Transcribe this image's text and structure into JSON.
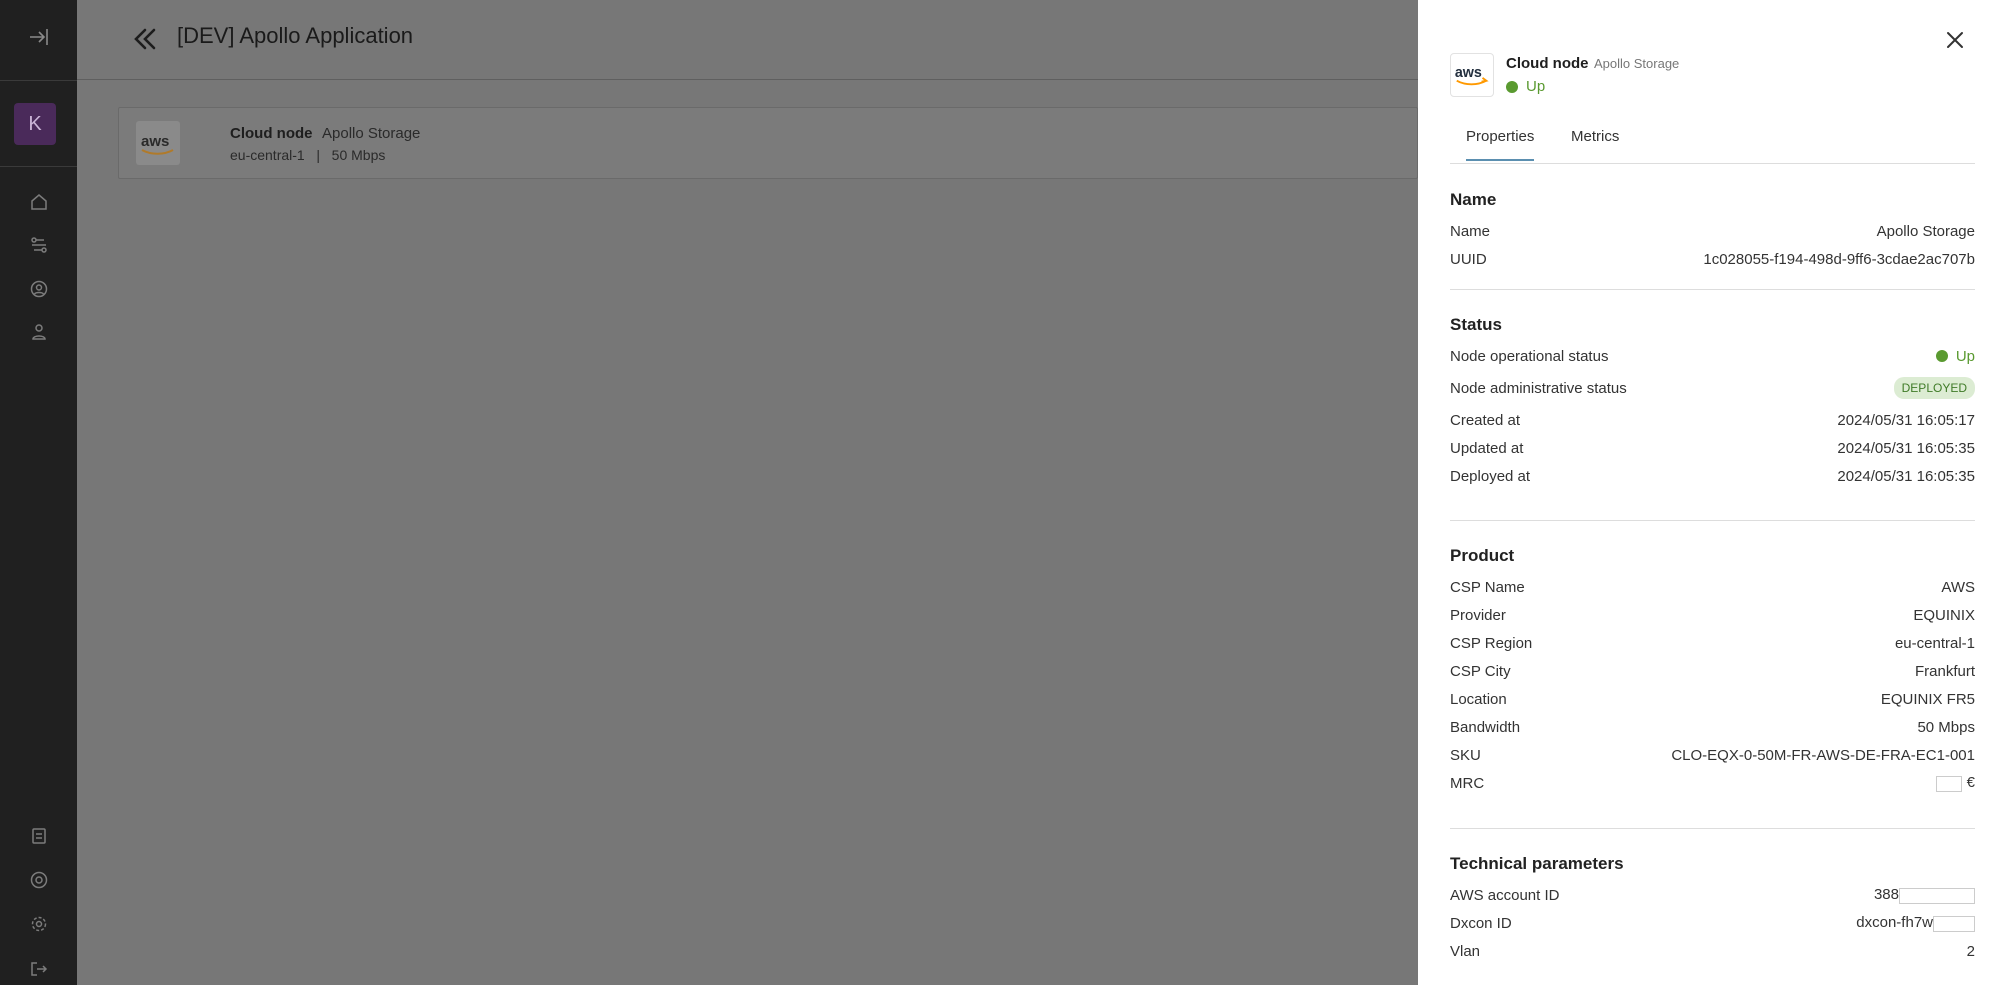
{
  "page_title": "[DEV] Apollo Application",
  "user_initial": "K",
  "card": {
    "kind": "Cloud node",
    "name": "Apollo Storage",
    "meta": "eu-central-1   |   50 Mbps"
  },
  "drawer": {
    "kind": "Cloud node",
    "name": "Apollo Storage",
    "status": "Up",
    "tabs": [
      "Properties",
      "Metrics"
    ],
    "sections": {
      "name": {
        "title": "Name",
        "rows": [
          {
            "k": "Name",
            "v": "Apollo Storage"
          },
          {
            "k": "UUID",
            "v": "1c028055-f194-498d-9ff6-3cdae2ac707b"
          }
        ]
      },
      "status": {
        "title": "Status",
        "operational_label": "Node operational status",
        "operational_value": "Up",
        "admin_label": "Node administrative status",
        "admin_value": "DEPLOYED",
        "rows": [
          {
            "k": "Created at",
            "v": "2024/05/31 16:05:17"
          },
          {
            "k": "Updated at",
            "v": "2024/05/31 16:05:35"
          },
          {
            "k": "Deployed at",
            "v": "2024/05/31 16:05:35"
          }
        ]
      },
      "product": {
        "title": "Product",
        "rows": [
          {
            "k": "CSP Name",
            "v": "AWS"
          },
          {
            "k": "Provider",
            "v": "EQUINIX"
          },
          {
            "k": "CSP Region",
            "v": "eu-central-1"
          },
          {
            "k": "CSP City",
            "v": "Frankfurt"
          },
          {
            "k": "Location",
            "v": "EQUINIX FR5"
          },
          {
            "k": "Bandwidth",
            "v": "50 Mbps"
          },
          {
            "k": "SKU",
            "v": "CLO-EQX-0-50M-FR-AWS-DE-FRA-EC1-001"
          }
        ],
        "mrc_label": "MRC",
        "mrc_currency": "€"
      },
      "technical": {
        "title": "Technical parameters",
        "aws_label": "AWS account ID",
        "aws_value": "388",
        "dxcon_label": "Dxcon ID",
        "dxcon_value": "dxcon-fh7w",
        "vlan_label": "Vlan",
        "vlan_value": "2"
      }
    }
  }
}
